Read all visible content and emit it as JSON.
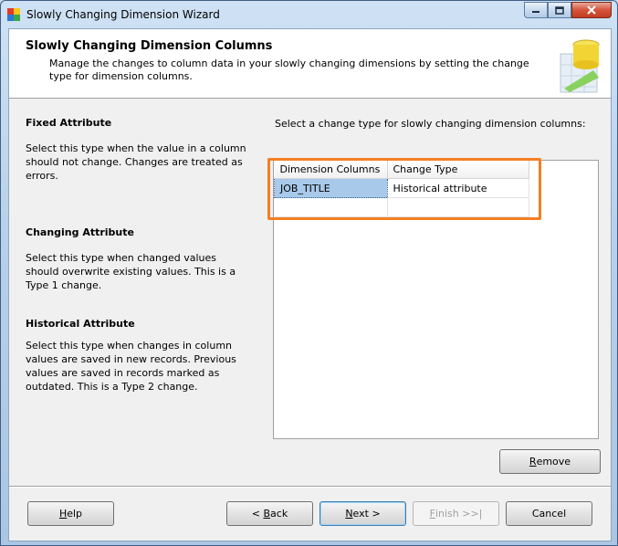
{
  "window": {
    "title": "Slowly Changing Dimension Wizard",
    "minimize_icon": "minimize-icon",
    "maximize_icon": "maximize-icon",
    "close_icon": "close-icon"
  },
  "header": {
    "title": "Slowly Changing Dimension Columns",
    "description": "Manage the changes to column data in your slowly changing dimensions by setting the change type for dimension columns."
  },
  "help_panel": {
    "sections": [
      {
        "heading": "Fixed Attribute",
        "text": "Select this type when the value in a column should not change. Changes are treated as errors."
      },
      {
        "heading": "Changing Attribute",
        "text": "Select this type when changed values should overwrite existing values. This is a Type 1 change."
      },
      {
        "heading": "Historical Attribute",
        "text": "Select this type when changes in column values are saved in new records. Previous values are saved in records marked as outdated. This is a Type 2 change."
      }
    ]
  },
  "instructions": "Select a change type for slowly changing dimension columns:",
  "grid": {
    "columns": [
      "Dimension Columns",
      "Change Type"
    ],
    "rows": [
      [
        "JOB_TITLE",
        "Historical attribute"
      ],
      [
        "",
        ""
      ]
    ]
  },
  "buttons": {
    "remove": {
      "prefix": "",
      "accel": "R",
      "suffix": "emove"
    },
    "help": {
      "prefix": "",
      "accel": "H",
      "suffix": "elp"
    },
    "back": {
      "prefix": "< ",
      "accel": "B",
      "suffix": "ack"
    },
    "next": {
      "prefix": "",
      "accel": "N",
      "suffix": "ext >"
    },
    "finish": {
      "prefix": "",
      "accel": "F",
      "suffix": "inish >>|"
    },
    "cancel": {
      "prefix": "Cancel",
      "accel": "",
      "suffix": ""
    }
  },
  "colors": {
    "highlight_border": "#f47f24",
    "selected_cell": "#a8c9ea"
  }
}
